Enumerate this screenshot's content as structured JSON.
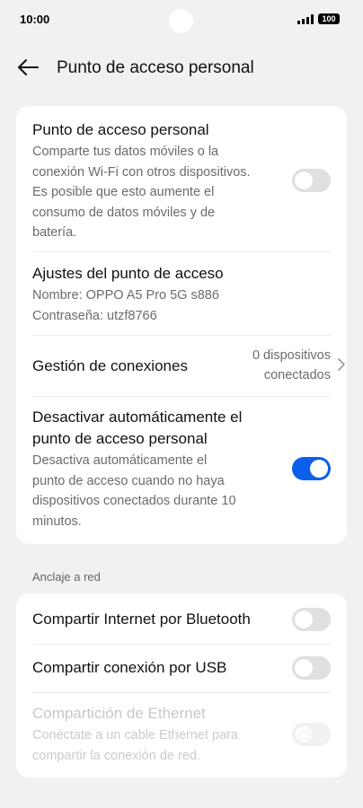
{
  "status_bar": {
    "time": "10:00",
    "battery": "100"
  },
  "appbar": {
    "title": "Punto de acceso personal"
  },
  "hotspot": {
    "title": "Punto de acceso personal",
    "description_lines": [
      "Comparte tus datos móviles o la",
      "conexión Wi-Fi con otros dispositivos.",
      "Es posible que esto aumente el",
      "consumo de datos móviles y de",
      "batería."
    ],
    "enabled": false
  },
  "settings": {
    "title": "Ajustes del punto de acceso",
    "name_line": "Nombre: OPPO A5 Pro 5G s886",
    "password_line": "Contraseña: utzf8766"
  },
  "connections": {
    "title": "Gestión de conexiones",
    "value_lines": [
      "0 dispositivos",
      "conectados"
    ]
  },
  "auto_off": {
    "title_lines": [
      "Desactivar automáticamente el",
      "punto de acceso personal"
    ],
    "description_lines": [
      "Desactiva automáticamente el",
      "punto de acceso cuando no haya",
      "dispositivos conectados durante 10",
      "minutos."
    ],
    "enabled": true
  },
  "tethering": {
    "section_label": "Anclaje a red",
    "bluetooth": {
      "title": "Compartir Internet por Bluetooth",
      "enabled": false
    },
    "usb": {
      "title": "Compartir conexión por USB",
      "enabled": false
    },
    "ethernet": {
      "title": "Compartición de Ethernet",
      "description_lines": [
        "Conéctate a un cable Ethernet para",
        "compartir la conexión de red."
      ],
      "enabled": false,
      "disabled": true
    }
  },
  "colors": {
    "accent": "#0b5fe8",
    "background": "#f1f1f3",
    "card": "#ffffff"
  }
}
